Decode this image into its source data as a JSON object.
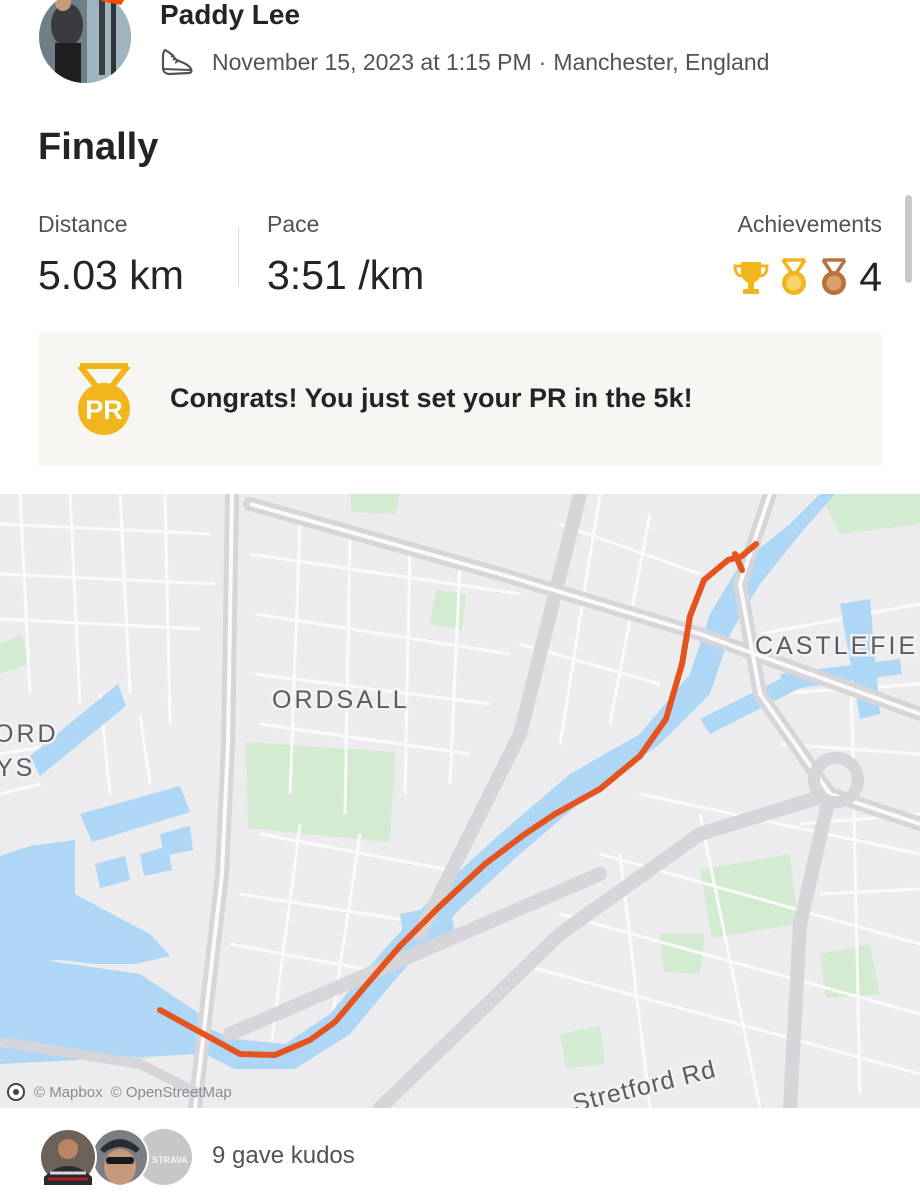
{
  "activity": {
    "athlete_name": "Paddy Lee",
    "icon": "run-shoe-icon",
    "date_time": "November 15, 2023 at 1:15 PM",
    "separator": "·",
    "location": "Manchester, England",
    "title": "Finally"
  },
  "stats": {
    "distance_label": "Distance",
    "distance_value": "5.03 km",
    "pace_label": "Pace",
    "pace_value": "3:51 /km",
    "achievements_label": "Achievements",
    "achievements_count": "4",
    "achievement_icons": [
      "trophy-icon",
      "gold-medal-icon",
      "bronze-medal-icon"
    ]
  },
  "banner": {
    "icon": "pr-medal-icon",
    "badge_text": "PR",
    "message": "Congrats! You just set your PR in the 5k!"
  },
  "map": {
    "labels": {
      "ordsall": "ORDSALL",
      "castlefield": "CASTLEFIE",
      "ord_left": "ORD",
      "ys_left": "YS",
      "stretford": "Stretford Rd"
    },
    "attribution": {
      "mapbox": "© Mapbox",
      "osm": "© OpenStreetMap"
    },
    "route_color": "#e5541f",
    "water_color": "#aed6f5"
  },
  "kudos": {
    "text": "9 gave kudos",
    "third_avatar_text": "STRAVA"
  },
  "colors": {
    "brand": "#fc4c02",
    "gold": "#f2b51b",
    "bronze": "#b8733d"
  }
}
